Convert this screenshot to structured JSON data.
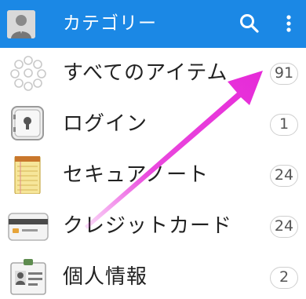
{
  "appbar": {
    "title": "カテゴリー",
    "avatar_icon": "user-avatar-icon",
    "search_icon": "search-icon",
    "more_icon": "more-vert-icon",
    "background": "#1b88e5"
  },
  "categories": [
    {
      "label": "すべてのアイテム",
      "count": "91",
      "icon": "all-items-icon"
    },
    {
      "label": "ログイン",
      "count": "1",
      "icon": "login-safe-icon"
    },
    {
      "label": "セキュアノート",
      "count": "24",
      "icon": "secure-note-icon"
    },
    {
      "label": "クレジットカード",
      "count": "24",
      "icon": "credit-card-icon"
    },
    {
      "label": "個人情報",
      "count": "2",
      "icon": "identity-card-icon"
    }
  ],
  "overlay": {
    "arrow_color": "#e62ad8",
    "arrow_icon": "annotation-arrow-icon"
  }
}
